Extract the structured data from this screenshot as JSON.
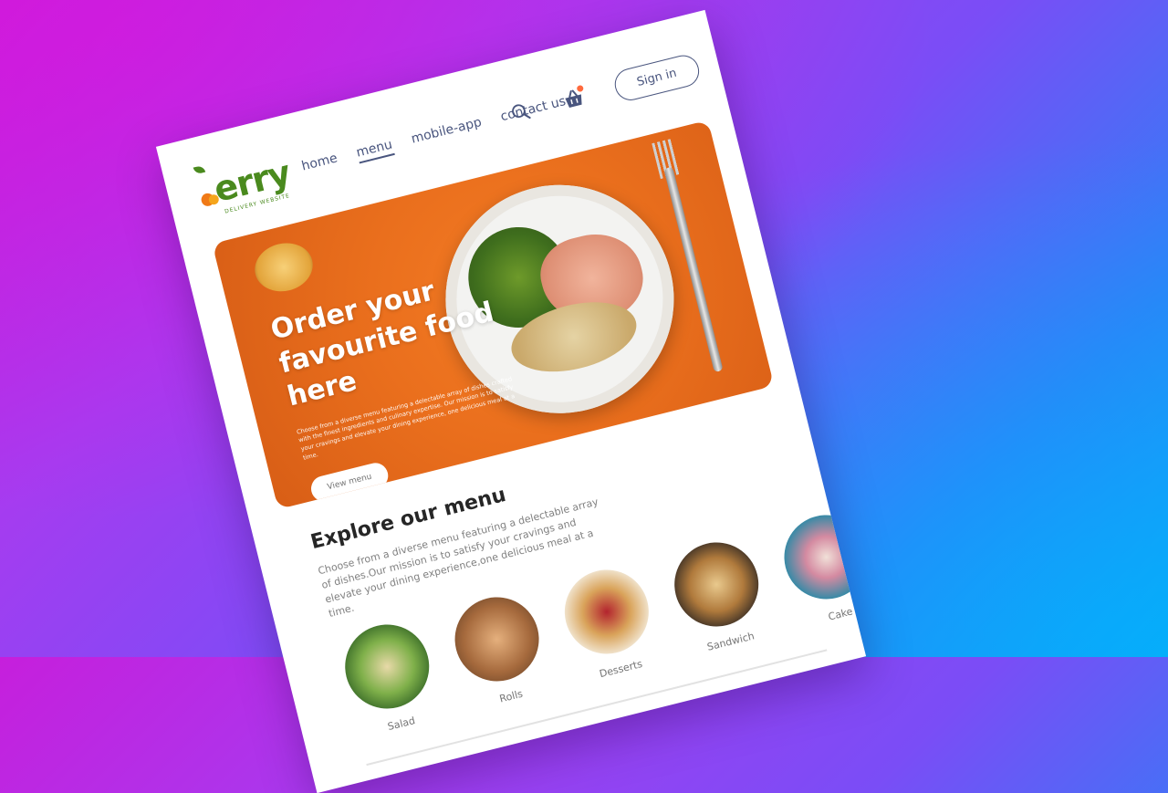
{
  "brand": {
    "logo_text": "erry",
    "tagline": "DELIVERY WEBSITE"
  },
  "nav": {
    "links": [
      "home",
      "menu",
      "mobile-app",
      "contact us"
    ],
    "active": "menu",
    "signin_label": "Sign in",
    "cart_has_items": true
  },
  "hero": {
    "title": "Order your favourite food here",
    "description": "Choose from a diverse menu featuring a delectable array of dishes crafted with the finest ingredients and culinary expertise. Our mission is to satisfy your cravings and elevate your dining experience, one delicious meal at a time.",
    "button_label": "View menu",
    "accent_color": "#ea6f1d"
  },
  "explore": {
    "title": "Explore our menu",
    "description": "Choose from a diverse menu featuring a delectable array of dishes.Our mission is to satisfy your cravings and elevate your dining experience,one delicious meal at a time.",
    "categories": [
      {
        "label": "Salad",
        "color": "#4e8a3a"
      },
      {
        "label": "Rolls",
        "color": "#a66a3d"
      },
      {
        "label": "Desserts",
        "color": "#d9a35a"
      },
      {
        "label": "Sandwich",
        "color": "#2d2622"
      },
      {
        "label": "Cake",
        "color": "#3a8aa6"
      }
    ]
  },
  "colors": {
    "text_primary": "#49557e",
    "heading": "#262626",
    "muted": "#808080"
  }
}
